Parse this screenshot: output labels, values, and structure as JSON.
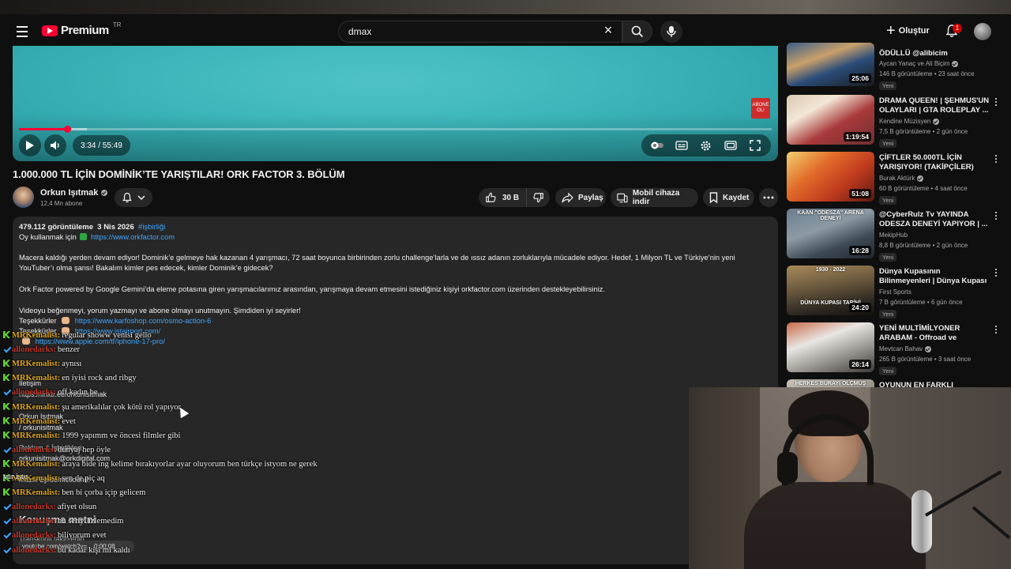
{
  "header": {
    "logo_text": "Premium",
    "logo_region": "TR",
    "search_value": "dmax",
    "create_label": "Oluştur",
    "notification_count": "1"
  },
  "player": {
    "time_display": "3:34 / 55:49",
    "progress_fraction": 0.064,
    "buffer_fraction": 0.09,
    "end_card": "ABONE OL!"
  },
  "video": {
    "title": "1.000.000 TL İÇİN DOMİNİK’TE YARIŞTILAR! ORK FACTOR 3. BÖLÜM",
    "channel_name": "Orkun Işıtmak",
    "subscribers": "12,4 Mn abone",
    "like_count": "30 B",
    "share_label": "Paylaş",
    "mobile_label": "Mobil cihaza indir",
    "save_label": "Kaydet"
  },
  "description": {
    "views": "479.112 görüntüleme",
    "date": "3 Nis 2026",
    "hashtag": "#işbirliği",
    "vote_prefix": "Oy kullanmak için",
    "vote_link": "https://www.orkfactor.com",
    "para1": "Macera kaldığı yerden devam ediyor! Dominik’e gelmeye hak kazanan 4 yarışmacı, 72 saat boyunca birbirinden zorlu challenge’larla ve de ıssız adanın zorluklarıyla mücadele ediyor. Hedef, 1 Milyon TL ve Türkiye’nin yeni YouTuber’ı olma şansı! Bakalım kimler pes edecek, kimler Dominik’e gidecek?",
    "para2": "Ork Factor powered by Google Gemini’da eleme potasına giren yarışmacılarımız arasından, yarışmaya devam etmesini istediğiniz kişiyi orkfactor.com üzerinden destekleyebilirsiniz.",
    "para3": "Videoyu beğenmeyi, yorum yazmayı ve abone olmayı unutmayın. Şimdiden iyi seyirler!",
    "thanks_label": "Teşekkürler",
    "thanks_link1": "https://www.karfoshop.com/osmo-action-6",
    "thanks_link2": "https://www.istairport.com/",
    "thanks_link3": "https://www.apple.com/tr/iphone-17-pro/",
    "faint": {
      "subtitle": "İletişim",
      "contact_link": "https://linktr.ee/orkunisitmak",
      "contact_name": "Orkun Işıtmak",
      "instagram": "/ orkunisitmak",
      "ads_label": "Reklam & İşbirlikleri:",
      "ads_mail": "orkunisitmak@orkdigital.com",
      "music_label": "Müzik Epidemicsound:"
    },
    "transcript_title": "Konuşma metni",
    "transcript_sub": "Transkripti takip edin",
    "transcript_btn": "youtube.com/watch?v=... 0:00:08"
  },
  "chat": [
    {
      "user": "MRKemalist",
      "color": "gold",
      "badge": "k",
      "text": "regular showw yenisi gelio"
    },
    {
      "user": "allonedarks",
      "color": "red",
      "badge": "check",
      "text": "benzer"
    },
    {
      "user": "MRKemalist",
      "color": "gold",
      "badge": "k",
      "text": "aynısı"
    },
    {
      "user": "MRKemalist",
      "color": "gold",
      "badge": "k",
      "text": "en iyisi rock and ribgy"
    },
    {
      "user": "allonedarks",
      "color": "red",
      "badge": "check",
      "text": "off kadın be"
    },
    {
      "user": "MRKemalist",
      "color": "gold",
      "badge": "k",
      "text": "şu amerikalılar çok kötü rol yapıyor"
    },
    {
      "user": "MRKemalist",
      "color": "gold",
      "badge": "k",
      "text": "evet"
    },
    {
      "user": "MRKemalist",
      "color": "gold",
      "badge": "k",
      "text": "1999 yapımm ve öncesi filmler gibi"
    },
    {
      "user": "allonedarks",
      "color": "red",
      "badge": "check",
      "text": "dunyaj hep öyle"
    },
    {
      "user": "MRKemalist",
      "color": "gold",
      "badge": "k",
      "text": "araya bide ing kelime bırakıyorlar ayar oluyorum ben türkçe istyom ne gerek"
    },
    {
      "user": "MRKemalist",
      "color": "gold",
      "badge": "k",
      "text": "sen de piç aq"
    },
    {
      "user": "MRKemalist",
      "color": "gold",
      "badge": "k",
      "text": "ben bi çorba içip gelicem"
    },
    {
      "user": "allonedarks",
      "color": "red",
      "badge": "check",
      "text": "afiyet olsun"
    },
    {
      "user": "allonedarks",
      "color": "red",
      "badge": "check",
      "text": "bu seriyi izlemedim"
    },
    {
      "user": "allonedarks",
      "color": "red",
      "badge": "check",
      "text": "biliyorum evet"
    },
    {
      "user": "allonedarks",
      "color": "red",
      "badge": "check",
      "text": "bu kadar kişi mi kaldı"
    }
  ],
  "chat_stray": "var işte",
  "sidebar": [
    {
      "title": "ÖDÜLLÜ @alibicim",
      "channel": "Aycan Yanaç ve Ali Biçim",
      "verified": true,
      "meta": "146 B görüntüleme • 23 saat önce",
      "badge": "Yeni",
      "duration": "25:06"
    },
    {
      "title": "DRAMA QUEEN! | ŞEHMUS'UN OLAYLARI | GTA ROLEPLAY ...",
      "channel": "Kendine Müzisyen",
      "verified": true,
      "meta": "7,5 B görüntüleme • 2 gün önce",
      "badge": "Yeni",
      "duration": "1:19:54"
    },
    {
      "title": "ÇİFTLER 50.000TL İÇİN YARIŞIYOR! (TAKİPÇİLER)",
      "channel": "Burak Aktürk",
      "verified": true,
      "meta": "60 B görüntüleme • 4 saat önce",
      "badge": "Yeni",
      "duration": "51:08"
    },
    {
      "title": "@CyberRulz Tv  YAYINDA ODESZA DENEYİ YAPIYOR | ...",
      "channel": "MekipHub",
      "verified": false,
      "meta": "8,8 B görüntüleme • 2 gün önce",
      "badge": "Yeni",
      "duration": "16:28"
    },
    {
      "title": "Dünya Kupasının Bilinmeyenleri | Dünya Kupası Tarihi (1930–...",
      "channel": "First Sports",
      "verified": false,
      "meta": "7 B görüntüleme • 6 gün önce",
      "badge": "Yeni",
      "duration": "24:20"
    },
    {
      "title": "YENİ MULTİMİLYONER ARABAM - Offroad ve driftistan ;)",
      "channel": "Mevtcan Bahav",
      "verified": true,
      "meta": "265 B görüntüleme • 3 saat önce",
      "badge": "Yeni",
      "duration": "26:14"
    },
    {
      "title": "OYUNUN EN FARKLI MAPİNDE 5",
      "channel": "",
      "verified": false,
      "meta": "",
      "badge": "",
      "duration": ""
    }
  ],
  "thumb_captions": {
    "t3": "KAAN \"ODESZA\" ARENA DENEYİ",
    "t4a": "1930 - 2022",
    "t4b": "DÜNYA KUPASI TARİHİ",
    "t6": "HERKES BURAYI ÖLÇMÜŞ"
  }
}
